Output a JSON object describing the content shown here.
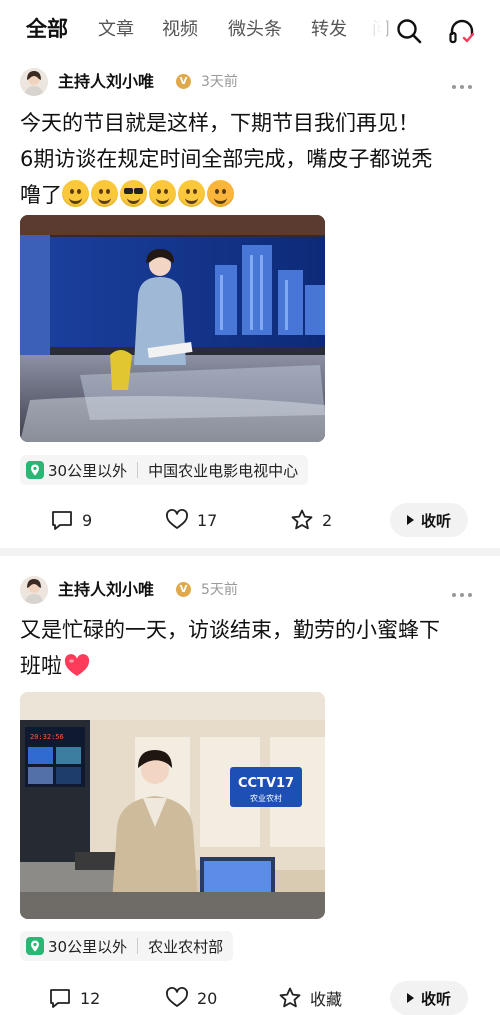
{
  "tabs": [
    {
      "label": "全部",
      "active": true
    },
    {
      "label": "文章",
      "active": false
    },
    {
      "label": "视频",
      "active": false
    },
    {
      "label": "微头条",
      "active": false
    },
    {
      "label": "转发",
      "active": false
    },
    {
      "label": "问",
      "active": false
    }
  ],
  "header_icons": [
    "search-icon",
    "headphones-icon"
  ],
  "colors": {
    "location_green": "#2bb673",
    "heart_red": "#ff3b5c",
    "badge_gold": "#e0a94c",
    "divider": "#f2f2f2"
  },
  "posts": [
    {
      "author": "主持人刘小唯",
      "verified_badge": "V",
      "time": "3天前",
      "text_line1": "今天的节目就是这样，下期节目我们再见！",
      "text_line2": "6期访谈在规定时间全部完成，嘴皮子都说秃",
      "text_line3": "噜了",
      "emojis": [
        "grin-emoji",
        "smile-emoji",
        "sunglasses-emoji",
        "thinking-emoji",
        "smirk-emoji",
        "star-struck-emoji"
      ],
      "location_distance": "30公里以外",
      "location_name": "中国农业电影电视中心",
      "comments": "9",
      "likes": "17",
      "favorites": "2",
      "listen_label": "收听"
    },
    {
      "author": "主持人刘小唯",
      "verified_badge": "V",
      "time": "5天前",
      "text_line1": "又是忙碌的一天，访谈结束，勤劳的小蜜蜂下",
      "text_line2": "班啦",
      "emojis": [
        "heart-emoji"
      ],
      "studio_logo_top": "CCTV17",
      "studio_logo_bottom": "农业农村",
      "monitor_time": "20:32:56",
      "location_distance": "30公里以外",
      "location_name": "农业农村部",
      "comments": "12",
      "likes": "20",
      "favorites": "收藏",
      "listen_label": "收听"
    }
  ]
}
